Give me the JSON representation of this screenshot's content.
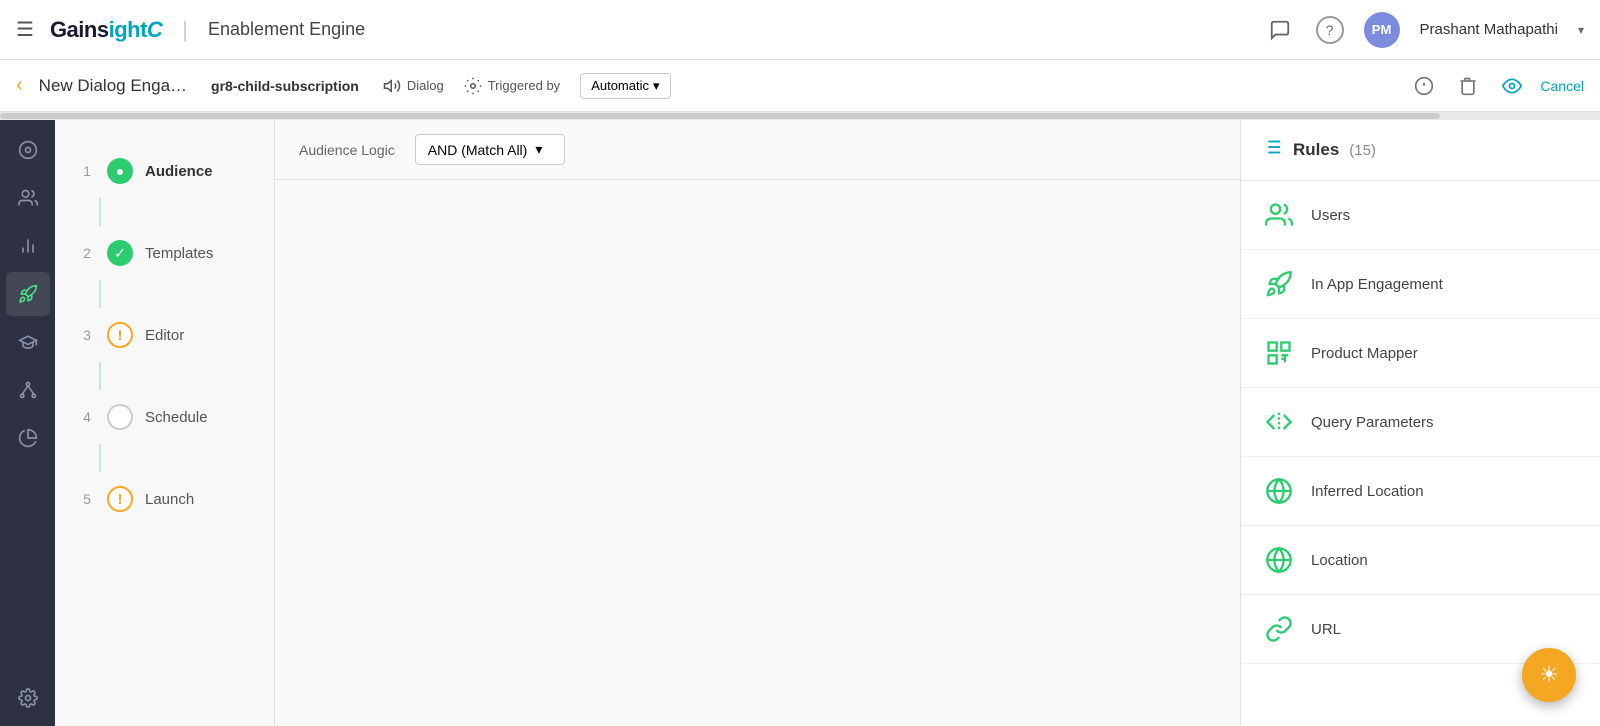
{
  "topNav": {
    "hamburger": "☰",
    "logoText": "Gainsight",
    "logoDivider": "|",
    "logoSubtitle": "Enablement Engine",
    "navIcons": [
      {
        "name": "chat-icon",
        "symbol": "💬"
      },
      {
        "name": "help-icon",
        "symbol": "?"
      }
    ],
    "avatarInitials": "PM",
    "userName": "Prashant Mathapathi",
    "chevron": "▾"
  },
  "subHeader": {
    "backArrow": "‹",
    "pageTitle": "New Dialog Enga…",
    "subscription": "gr8-child-subscription",
    "dialogLabel": "Dialog",
    "triggeredBy": "Triggered by",
    "automatic": "Automatic",
    "chevron": "▾",
    "cancelLabel": "Cancel"
  },
  "steps": [
    {
      "number": "1",
      "type": "green",
      "label": "Audience",
      "active": true
    },
    {
      "number": "2",
      "type": "green-check",
      "label": "Templates",
      "active": false
    },
    {
      "number": "3",
      "type": "warning",
      "label": "Editor",
      "active": false
    },
    {
      "number": "4",
      "type": "outline",
      "label": "Schedule",
      "active": false
    },
    {
      "number": "5",
      "type": "warning",
      "label": "Launch",
      "active": false
    }
  ],
  "contentToolbar": {
    "audienceLogicLabel": "Audience Logic",
    "dropdownValue": "AND (Match All)",
    "dropdownChevron": "▾"
  },
  "rulesPanel": {
    "title": "Rules",
    "count": "(15)",
    "items": [
      {
        "name": "users",
        "label": "Users"
      },
      {
        "name": "in-app-engagement",
        "label": "In App Engagement"
      },
      {
        "name": "product-mapper",
        "label": "Product Mapper"
      },
      {
        "name": "query-parameters",
        "label": "Query Parameters"
      },
      {
        "name": "inferred-location",
        "label": "Inferred Location"
      },
      {
        "name": "location",
        "label": "Location"
      },
      {
        "name": "url",
        "label": "URL"
      }
    ]
  },
  "sidebarIcons": [
    {
      "name": "home-icon",
      "symbol": "⊙"
    },
    {
      "name": "people-icon",
      "symbol": "👥"
    },
    {
      "name": "chart-icon",
      "symbol": "📊"
    },
    {
      "name": "rocket-icon",
      "symbol": "🚀"
    },
    {
      "name": "graduation-icon",
      "symbol": "🎓"
    },
    {
      "name": "network-icon",
      "symbol": "⬡"
    },
    {
      "name": "pie-icon",
      "symbol": "◔"
    },
    {
      "name": "settings-icon",
      "symbol": "⚙"
    }
  ]
}
